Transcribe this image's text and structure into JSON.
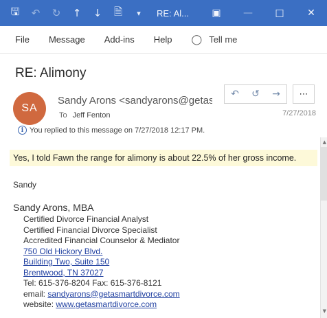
{
  "titlebar": {
    "title": "RE: Al...",
    "icons": [
      "save-icon",
      "undo-icon",
      "redo-icon",
      "up-arrow-icon",
      "down-arrow-icon",
      "document-icon",
      "customize-icon"
    ],
    "controls": [
      "restore-window-icon",
      "minimize-icon",
      "maximize-icon",
      "close-icon"
    ]
  },
  "menu": {
    "items": [
      "File",
      "Message",
      "Add-ins",
      "Help"
    ],
    "tell_me": "Tell me"
  },
  "message": {
    "subject": "RE: Alimony",
    "avatar_initials": "SA",
    "sender": "Sandy Arons <sandyarons@getasr",
    "to_label": "To",
    "recipient": "Jeff Fenton",
    "date": "7/27/2018",
    "info": "You replied to this message on 7/27/2018 12:17 PM."
  },
  "body": {
    "highlight": "Yes, I told Fawn the range for alimony is about 22.5% of her gross income.",
    "sign_off": "Sandy"
  },
  "signature": {
    "name": "Sandy Arons, MBA",
    "line1": "Certified Divorce Financial Analyst",
    "line2": "Certified Financial Divorce Specialist",
    "line3": "Accredited Financial Counselor & Mediator",
    "addr1": "750 Old Hickory Blvd.",
    "addr2": "Building Two, Suite 150",
    "addr3": "Brentwood, TN  37027",
    "phone": "Tel: 615-376-8204 Fax: 615-376-8121",
    "email_label": "email:",
    "email": "sandyarons@getasmartdivorce.com",
    "website_label": "website:",
    "website": "www.getasmartdivorce.com"
  },
  "colors": {
    "titlebar": "#3b6fc3",
    "avatar": "#d0693f",
    "highlight": "#fdf9d9",
    "link": "#1f3fa0"
  }
}
